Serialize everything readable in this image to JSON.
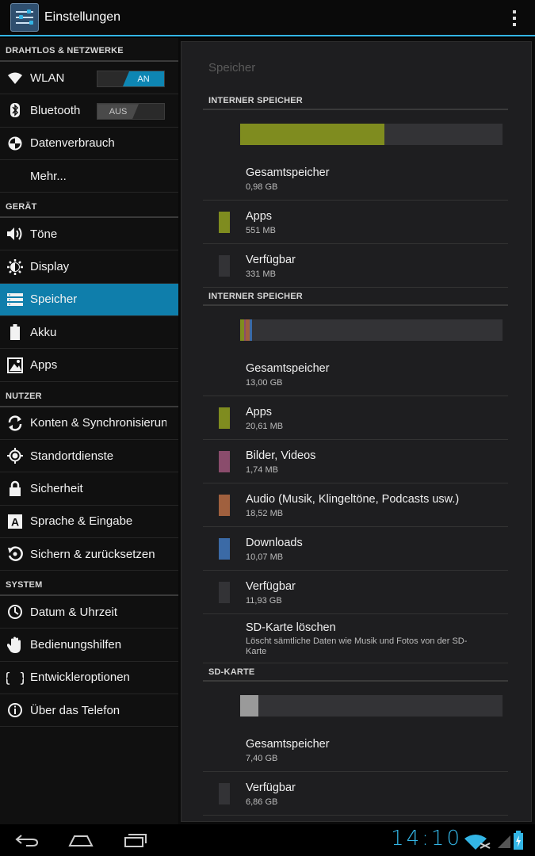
{
  "app_bar": {
    "title": "Einstellungen"
  },
  "sidebar": {
    "sections": [
      {
        "header": "DRAHTLOS & NETZWERKE",
        "items": [
          {
            "label": "WLAN",
            "icon": "wifi-icon",
            "toggle": "AN"
          },
          {
            "label": "Bluetooth",
            "icon": "bluetooth-icon",
            "toggle": "AUS"
          },
          {
            "label": "Datenverbrauch",
            "icon": "data-usage-icon"
          },
          {
            "label": "Mehr...",
            "icon": ""
          }
        ]
      },
      {
        "header": "GERÄT",
        "items": [
          {
            "label": "Töne",
            "icon": "sound-icon"
          },
          {
            "label": "Display",
            "icon": "display-icon"
          },
          {
            "label": "Speicher",
            "icon": "storage-icon",
            "selected": true
          },
          {
            "label": "Akku",
            "icon": "battery-icon"
          },
          {
            "label": "Apps",
            "icon": "apps-icon"
          }
        ]
      },
      {
        "header": "NUTZER",
        "items": [
          {
            "label": "Konten & Synchronisierung",
            "icon": "sync-icon"
          },
          {
            "label": "Standortdienste",
            "icon": "location-icon"
          },
          {
            "label": "Sicherheit",
            "icon": "lock-icon"
          },
          {
            "label": "Sprache & Eingabe",
            "icon": "language-icon"
          },
          {
            "label": "Sichern & zurücksetzen",
            "icon": "backup-icon"
          }
        ]
      },
      {
        "header": "SYSTEM",
        "items": [
          {
            "label": "Datum & Uhrzeit",
            "icon": "clock-icon"
          },
          {
            "label": "Bedienungshilfen",
            "icon": "hand-icon"
          },
          {
            "label": "Entwickleroptionen",
            "icon": "braces-icon"
          },
          {
            "label": "Über das Telefon",
            "icon": "info-icon"
          }
        ]
      }
    ]
  },
  "panel": {
    "title": "Speicher",
    "sections": [
      {
        "header": "INTERNER SPEICHER",
        "bar": [
          {
            "color": "#7f8c1f",
            "fraction": 0.55
          }
        ],
        "rows": [
          {
            "title": "Gesamtspeicher",
            "value": "0,98 GB"
          },
          {
            "title": "Apps",
            "value": "551 MB",
            "color": "#7f8c1f"
          },
          {
            "title": "Verfügbar",
            "value": "331 MB",
            "color": "#333336"
          }
        ]
      },
      {
        "header": "INTERNER SPEICHER",
        "bar": [
          {
            "color": "#7f8c1f",
            "fraction": 0.016
          },
          {
            "color": "#8a4c6c",
            "fraction": 0.006
          },
          {
            "color": "#a0603e",
            "fraction": 0.014
          },
          {
            "color": "#3b6aa6",
            "fraction": 0.009
          }
        ],
        "rows": [
          {
            "title": "Gesamtspeicher",
            "value": "13,00 GB"
          },
          {
            "title": "Apps",
            "value": "20,61 MB",
            "color": "#7f8c1f"
          },
          {
            "title": "Bilder, Videos",
            "value": "1,74 MB",
            "color": "#8a4c6c"
          },
          {
            "title": "Audio (Musik, Klingeltöne, Podcasts usw.)",
            "value": "18,52 MB",
            "color": "#a0603e"
          },
          {
            "title": "Downloads",
            "value": "10,07 MB",
            "color": "#3b6aa6"
          },
          {
            "title": "Verfügbar",
            "value": "11,93 GB",
            "color": "#333336"
          },
          {
            "title": "SD-Karte löschen",
            "value": "Löscht sämtliche Daten wie Musik und Fotos von der SD-Karte"
          }
        ]
      },
      {
        "header": "SD-KARTE",
        "bar": [
          {
            "color": "#9a9a9a",
            "fraction": 0.07
          }
        ],
        "rows": [
          {
            "title": "Gesamtspeicher",
            "value": "7,40 GB"
          },
          {
            "title": "Verfügbar",
            "value": "6,86 GB",
            "color": "#333336"
          }
        ]
      }
    ]
  },
  "status_bar": {
    "time": "14:10"
  }
}
